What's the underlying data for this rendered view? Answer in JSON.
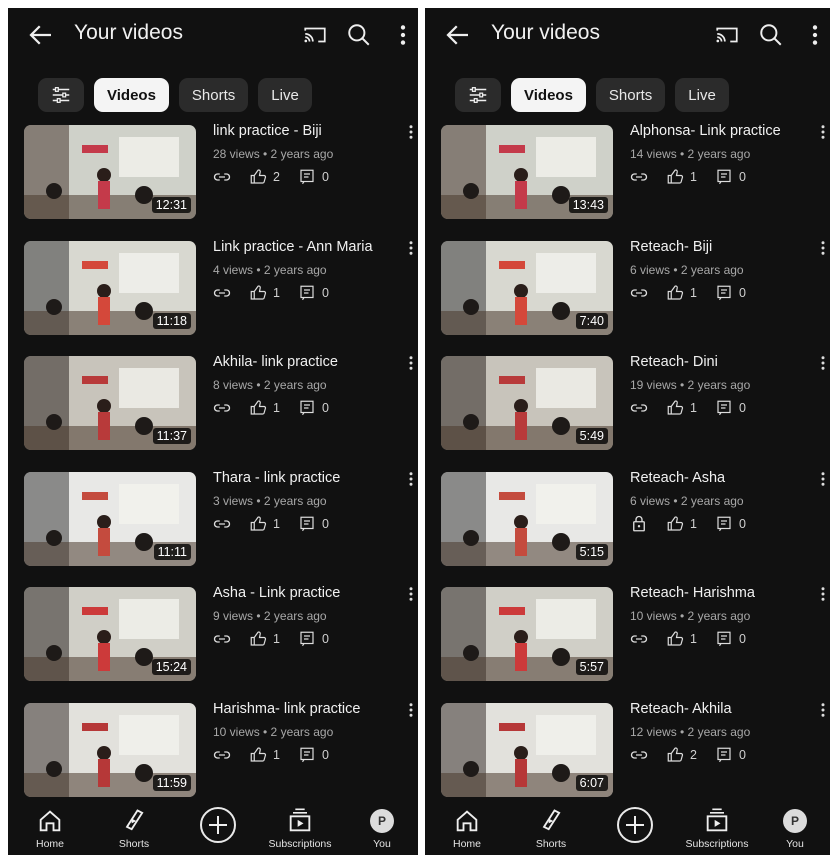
{
  "panels": [
    {
      "title": "Your videos",
      "chips": [
        "Videos",
        "Shorts",
        "Live"
      ],
      "videos": [
        {
          "title": "link practice - Biji",
          "meta": "28 views • 2 years ago",
          "duration": "12:31",
          "likes": "2",
          "comments": "0",
          "privacy": "link"
        },
        {
          "title": "Link practice - Ann Maria",
          "meta": "4 views • 2 years ago",
          "duration": "11:18",
          "likes": "1",
          "comments": "0",
          "privacy": "link"
        },
        {
          "title": "Akhila- link practice",
          "meta": "8 views • 2 years ago",
          "duration": "11:37",
          "likes": "1",
          "comments": "0",
          "privacy": "link"
        },
        {
          "title": "Thara - link practice",
          "meta": "3 views • 2 years ago",
          "duration": "11:11",
          "likes": "1",
          "comments": "0",
          "privacy": "link"
        },
        {
          "title": "Asha - Link practice",
          "meta": "9 views • 2 years ago",
          "duration": "15:24",
          "likes": "1",
          "comments": "0",
          "privacy": "link"
        },
        {
          "title": "Harishma- link practice",
          "meta": "10 views • 2 years ago",
          "duration": "11:59",
          "likes": "1",
          "comments": "0",
          "privacy": "link"
        }
      ],
      "nav": {
        "home": "Home",
        "shorts": "Shorts",
        "subscriptions": "Subscriptions",
        "you": "You",
        "avatar_letter": "P"
      }
    },
    {
      "title": "Your videos",
      "chips": [
        "Videos",
        "Shorts",
        "Live"
      ],
      "videos": [
        {
          "title": "Alphonsa- Link practice",
          "meta": "14 views • 2 years ago",
          "duration": "13:43",
          "likes": "1",
          "comments": "0",
          "privacy": "link"
        },
        {
          "title": "Reteach- Biji",
          "meta": "6 views • 2 years ago",
          "duration": "7:40",
          "likes": "1",
          "comments": "0",
          "privacy": "link"
        },
        {
          "title": "Reteach- Dini",
          "meta": "19 views • 2 years ago",
          "duration": "5:49",
          "likes": "1",
          "comments": "0",
          "privacy": "link"
        },
        {
          "title": "Reteach- Asha",
          "meta": "6 views • 2 years ago",
          "duration": "5:15",
          "likes": "1",
          "comments": "0",
          "privacy": "lock"
        },
        {
          "title": "Reteach- Harishma",
          "meta": "10 views • 2 years ago",
          "duration": "5:57",
          "likes": "1",
          "comments": "0",
          "privacy": "link"
        },
        {
          "title": "Reteach- Akhila",
          "meta": "12 views • 2 years ago",
          "duration": "6:07",
          "likes": "2",
          "comments": "0",
          "privacy": "link"
        }
      ],
      "nav": {
        "home": "Home",
        "shorts": "Shorts",
        "subscriptions": "Subscriptions",
        "you": "You",
        "avatar_letter": "P"
      }
    }
  ]
}
